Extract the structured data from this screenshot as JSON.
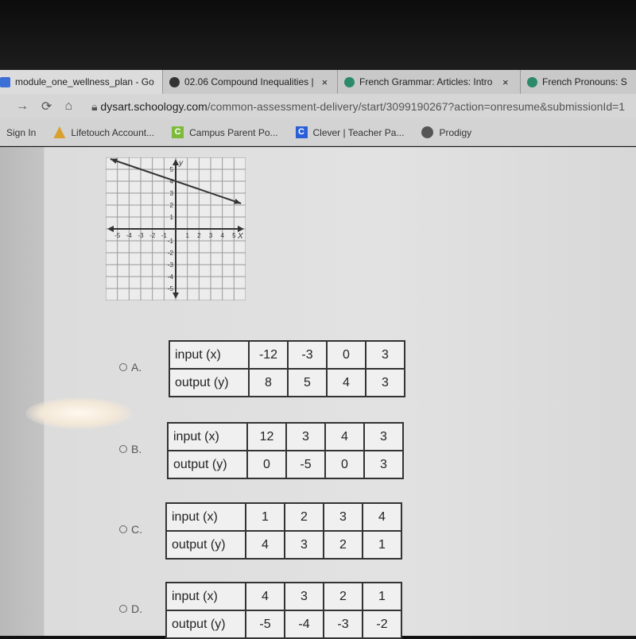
{
  "browser": {
    "tabs": [
      {
        "title": "module_one_wellness_plan - Go",
        "icon": "google-docs-icon",
        "color": "#3b6fd6"
      },
      {
        "title": "02.06 Compound Inequalities |",
        "icon": "schoology-icon",
        "color": "#333333"
      },
      {
        "title": "French Grammar: Articles: Intro",
        "icon": "globe-icon",
        "color": "#2a8a6a"
      },
      {
        "title": "French Pronouns: S",
        "icon": "globe-icon",
        "color": "#2a8a6a"
      }
    ],
    "close_glyph": "×",
    "url_domain": "dysart.schoology.com",
    "url_path": "/common-assessment-delivery/start/3099190267?action=onresume&submissionId=1",
    "bookmarks": [
      {
        "label": "Sign In",
        "icon": ""
      },
      {
        "label": "Lifetouch Account...",
        "icon": "lifetouch-icon",
        "color": "#d9a030"
      },
      {
        "label": "Campus Parent Po...",
        "icon": "C",
        "color": "#7cbb3a"
      },
      {
        "label": "Clever | Teacher Pa...",
        "icon": "C",
        "color": "#2b5fd9"
      },
      {
        "label": "Prodigy",
        "icon": "prodigy-icon",
        "color": "#555555"
      }
    ]
  },
  "graph": {
    "x_label": "X",
    "y_label": "y",
    "x_ticks": [
      "-5",
      "-4",
      "-3",
      "-2",
      "-1",
      "1",
      "2",
      "3",
      "4",
      "5"
    ],
    "y_ticks": [
      "5",
      "4",
      "3",
      "2",
      "1",
      "-1",
      "-2",
      "-3",
      "-4",
      "-5"
    ],
    "range": [
      -6,
      6
    ],
    "line_through": [
      [
        0,
        4
      ],
      [
        3,
        3
      ]
    ]
  },
  "choices": [
    {
      "letter": "A.",
      "input_label": "input (x)",
      "output_label": "output (y)",
      "inputs": [
        "-12",
        "-3",
        "0",
        "3"
      ],
      "outputs": [
        "8",
        "5",
        "4",
        "3"
      ]
    },
    {
      "letter": "B.",
      "input_label": "input (x)",
      "output_label": "output (y)",
      "inputs": [
        "12",
        "3",
        "4",
        "3"
      ],
      "outputs": [
        "0",
        "-5",
        "0",
        "3"
      ]
    },
    {
      "letter": "C.",
      "input_label": "input (x)",
      "output_label": "output (y)",
      "inputs": [
        "1",
        "2",
        "3",
        "4"
      ],
      "outputs": [
        "4",
        "3",
        "2",
        "1"
      ]
    },
    {
      "letter": "D.",
      "input_label": "input (x)",
      "output_label": "output (y)",
      "inputs": [
        "4",
        "3",
        "2",
        "1"
      ],
      "outputs": [
        "-5",
        "-4",
        "-3",
        "-2"
      ]
    }
  ]
}
